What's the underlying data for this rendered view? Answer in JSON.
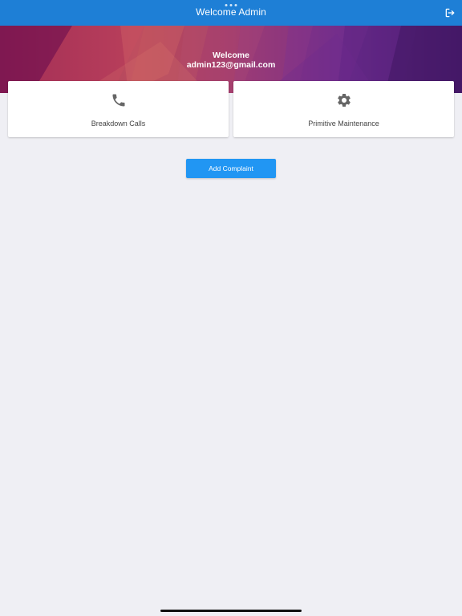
{
  "nav": {
    "title": "Welcome Admin",
    "logout_icon": "logout-icon",
    "color": "#1e7fd6"
  },
  "header": {
    "welcome_label": "Welcome",
    "email": "admin123@gmail.com"
  },
  "cards": [
    {
      "label": "Breakdown Calls",
      "icon": "phone-icon"
    },
    {
      "label": "Primitive Maintenance",
      "icon": "gear-icon"
    }
  ],
  "actions": {
    "add_complaint_label": "Add Complaint",
    "button_color": "#2196f3"
  }
}
